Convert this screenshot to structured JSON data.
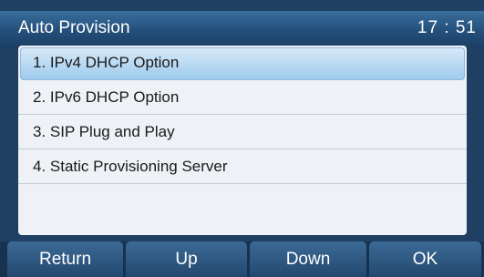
{
  "titlebar": {
    "title": "Auto Provision",
    "time": "17 : 51"
  },
  "menu": {
    "items": [
      {
        "label": "1. IPv4 DHCP Option",
        "selected": true
      },
      {
        "label": "2. IPv6 DHCP Option",
        "selected": false
      },
      {
        "label": "3. SIP Plug and Play",
        "selected": false
      },
      {
        "label": "4. Static Provisioning Server",
        "selected": false
      }
    ]
  },
  "softkeys": {
    "return_label": "Return",
    "up_label": "Up",
    "down_label": "Down",
    "ok_label": "OK"
  },
  "colors": {
    "background": "#1f3f63",
    "panel": "#eef1f5",
    "highlight": "#9ecbee",
    "softkey": "#2f5c88"
  }
}
